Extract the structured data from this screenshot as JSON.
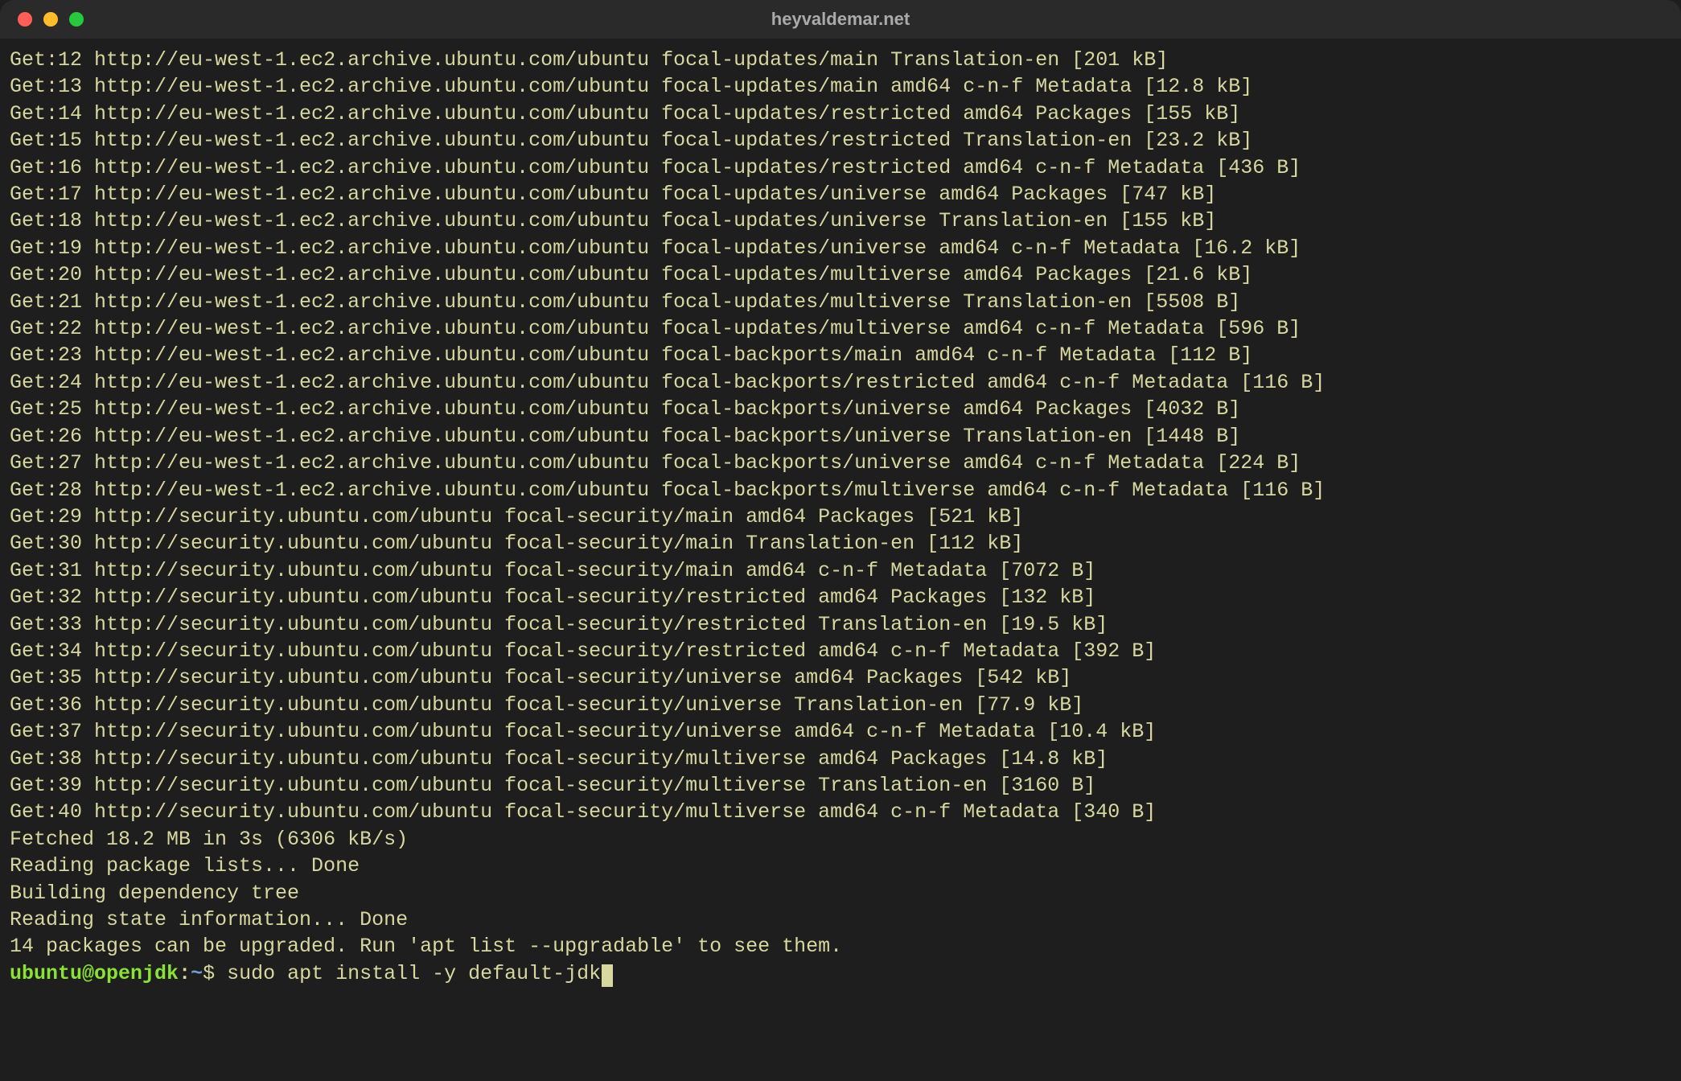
{
  "window": {
    "title": "heyvaldemar.net"
  },
  "output_lines": [
    "Get:12 http://eu-west-1.ec2.archive.ubuntu.com/ubuntu focal-updates/main Translation-en [201 kB]",
    "Get:13 http://eu-west-1.ec2.archive.ubuntu.com/ubuntu focal-updates/main amd64 c-n-f Metadata [12.8 kB]",
    "Get:14 http://eu-west-1.ec2.archive.ubuntu.com/ubuntu focal-updates/restricted amd64 Packages [155 kB]",
    "Get:15 http://eu-west-1.ec2.archive.ubuntu.com/ubuntu focal-updates/restricted Translation-en [23.2 kB]",
    "Get:16 http://eu-west-1.ec2.archive.ubuntu.com/ubuntu focal-updates/restricted amd64 c-n-f Metadata [436 B]",
    "Get:17 http://eu-west-1.ec2.archive.ubuntu.com/ubuntu focal-updates/universe amd64 Packages [747 kB]",
    "Get:18 http://eu-west-1.ec2.archive.ubuntu.com/ubuntu focal-updates/universe Translation-en [155 kB]",
    "Get:19 http://eu-west-1.ec2.archive.ubuntu.com/ubuntu focal-updates/universe amd64 c-n-f Metadata [16.2 kB]",
    "Get:20 http://eu-west-1.ec2.archive.ubuntu.com/ubuntu focal-updates/multiverse amd64 Packages [21.6 kB]",
    "Get:21 http://eu-west-1.ec2.archive.ubuntu.com/ubuntu focal-updates/multiverse Translation-en [5508 B]",
    "Get:22 http://eu-west-1.ec2.archive.ubuntu.com/ubuntu focal-updates/multiverse amd64 c-n-f Metadata [596 B]",
    "Get:23 http://eu-west-1.ec2.archive.ubuntu.com/ubuntu focal-backports/main amd64 c-n-f Metadata [112 B]",
    "Get:24 http://eu-west-1.ec2.archive.ubuntu.com/ubuntu focal-backports/restricted amd64 c-n-f Metadata [116 B]",
    "Get:25 http://eu-west-1.ec2.archive.ubuntu.com/ubuntu focal-backports/universe amd64 Packages [4032 B]",
    "Get:26 http://eu-west-1.ec2.archive.ubuntu.com/ubuntu focal-backports/universe Translation-en [1448 B]",
    "Get:27 http://eu-west-1.ec2.archive.ubuntu.com/ubuntu focal-backports/universe amd64 c-n-f Metadata [224 B]",
    "Get:28 http://eu-west-1.ec2.archive.ubuntu.com/ubuntu focal-backports/multiverse amd64 c-n-f Metadata [116 B]",
    "Get:29 http://security.ubuntu.com/ubuntu focal-security/main amd64 Packages [521 kB]",
    "Get:30 http://security.ubuntu.com/ubuntu focal-security/main Translation-en [112 kB]",
    "Get:31 http://security.ubuntu.com/ubuntu focal-security/main amd64 c-n-f Metadata [7072 B]",
    "Get:32 http://security.ubuntu.com/ubuntu focal-security/restricted amd64 Packages [132 kB]",
    "Get:33 http://security.ubuntu.com/ubuntu focal-security/restricted Translation-en [19.5 kB]",
    "Get:34 http://security.ubuntu.com/ubuntu focal-security/restricted amd64 c-n-f Metadata [392 B]",
    "Get:35 http://security.ubuntu.com/ubuntu focal-security/universe amd64 Packages [542 kB]",
    "Get:36 http://security.ubuntu.com/ubuntu focal-security/universe Translation-en [77.9 kB]",
    "Get:37 http://security.ubuntu.com/ubuntu focal-security/universe amd64 c-n-f Metadata [10.4 kB]",
    "Get:38 http://security.ubuntu.com/ubuntu focal-security/multiverse amd64 Packages [14.8 kB]",
    "Get:39 http://security.ubuntu.com/ubuntu focal-security/multiverse Translation-en [3160 B]",
    "Get:40 http://security.ubuntu.com/ubuntu focal-security/multiverse amd64 c-n-f Metadata [340 B]",
    "Fetched 18.2 MB in 3s (6306 kB/s)",
    "Reading package lists... Done",
    "Building dependency tree",
    "Reading state information... Done",
    "14 packages can be upgraded. Run 'apt list --upgradable' to see them."
  ],
  "prompt": {
    "user": "ubuntu",
    "at": "@",
    "host": "openjdk",
    "colon": ":",
    "path": "~",
    "dollar": "$ ",
    "command": "sudo apt install -y default-jdk"
  }
}
